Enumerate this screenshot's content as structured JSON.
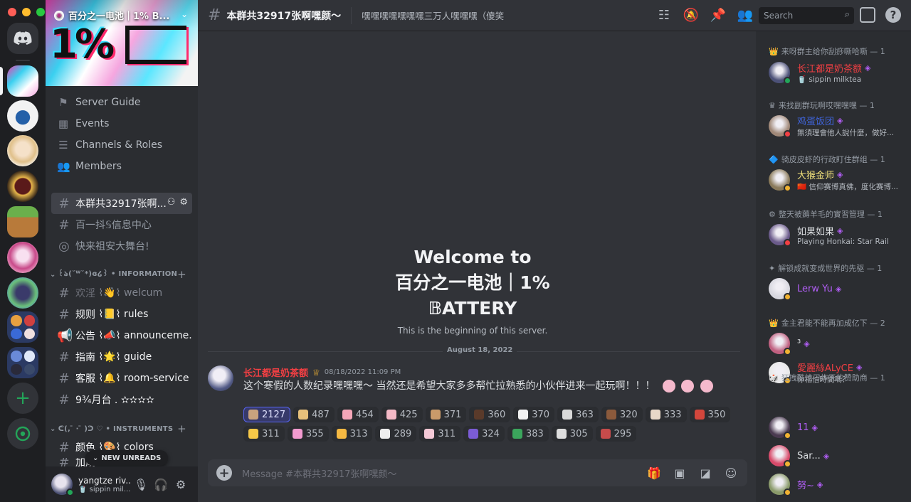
{
  "window": {
    "dots": [
      "#ff5f57",
      "#febc2e",
      "#28c840"
    ]
  },
  "server": {
    "name": "百分之一电池｜1% B...",
    "banner_text": "1%",
    "nav": [
      {
        "label": "Server Guide",
        "icon": "signpost-icon"
      },
      {
        "label": "Events",
        "icon": "calendar-icon"
      },
      {
        "label": "Channels & Roles",
        "icon": "channels-icon"
      },
      {
        "label": "Members",
        "icon": "members-icon"
      }
    ],
    "channels_top": [
      {
        "name": "本群共32917张啊...",
        "active": true
      },
      {
        "name": "百一抖𝕊信息中心"
      },
      {
        "name": "快来祖安大舞台!"
      }
    ],
    "categories": [
      "꒰ঌ(˘ᵂ˘*)ɞ໒꒱ • INFORMATION",
      "ᕦ(,  ̄ · ̄ )ᕤ ♡ • INSTRUMENTS"
    ],
    "info_channels": [
      {
        "name": "欢淫",
        "emoji": "👋",
        "sub": "welcum"
      },
      {
        "name": "规则",
        "emoji": "📒",
        "sub": "rules"
      },
      {
        "name": "公告",
        "emoji": "📣",
        "sub": "announceme..."
      },
      {
        "name": "指南",
        "emoji": "🌟",
        "sub": "guide"
      },
      {
        "name": "客服",
        "emoji": "🔔",
        "sub": "room-service"
      },
      {
        "name": "9¾月台 . ✫✫✫✫",
        "emoji": "",
        "sub": ""
      }
    ],
    "instr_channels": [
      {
        "name": "颜色",
        "emoji": "🎨",
        "sub": "colors"
      },
      {
        "name": "加成",
        "emoji": "",
        "sub": "boost"
      }
    ],
    "new_unreads": "NEW UNREADS"
  },
  "user": {
    "name": "yangtze riv...",
    "status": "🥤 sippin mil..."
  },
  "topbar": {
    "title": "本群共32917张啊嘿颜～",
    "topic": "嘿嘿嘿嘿嘿嘿嘿三万人嘿嘿嘿（傻笑",
    "search_placeholder": "Search"
  },
  "welcome": {
    "line1": "Welcome to",
    "line2": "百分之一电池｜1%",
    "line3": "𝔹ATTERY",
    "subtitle": "This is the beginning of this server.",
    "date": "August 18, 2022"
  },
  "message": {
    "author": "长江都是奶茶额",
    "timestamp": "08/18/2022 11:09 PM",
    "text": "这个寒假的人数纪录嘿嘿嘿～ 当然还是希望大家多多帮忙拉熟悉的小伙伴进来一起玩啊！！！",
    "reactions_row1": [
      {
        "count": "2127",
        "color": "#c9a37e",
        "me": true
      },
      {
        "count": "487",
        "color": "#e6c07b"
      },
      {
        "count": "454",
        "color": "#f4a6b8"
      },
      {
        "count": "425",
        "color": "#f4b9c6"
      },
      {
        "count": "371",
        "color": "#c99a6a"
      },
      {
        "count": "360",
        "color": "#5a3a2a"
      },
      {
        "count": "370",
        "color": "#f1f1f1"
      },
      {
        "count": "363",
        "color": "#d9d9d9"
      },
      {
        "count": "320",
        "color": "#8b5a3c"
      },
      {
        "count": "333",
        "color": "#e8d8c8"
      },
      {
        "count": "350",
        "color": "#d2463c"
      }
    ],
    "reactions_row2": [
      {
        "count": "311",
        "color": "#f7c948"
      },
      {
        "count": "355",
        "color": "#f39bd0"
      },
      {
        "count": "313",
        "color": "#f5b942"
      },
      {
        "count": "289",
        "color": "#eeeeee"
      },
      {
        "count": "311",
        "color": "#f4c9d6"
      },
      {
        "count": "324",
        "color": "#7b5cd6"
      },
      {
        "count": "383",
        "color": "#3ba55c"
      },
      {
        "count": "305",
        "color": "#dedede"
      },
      {
        "count": "295",
        "color": "#c54b4b"
      }
    ]
  },
  "composer": {
    "placeholder": "Message #本群共32917张啊嘿颜～"
  },
  "members": {
    "groups": [
      {
        "role": "来呀群主给你刮痧嘶哈嘶 — 1",
        "icon": "👑",
        "m": {
          "name": "长江都是奶茶额",
          "status": "🥤 sippin milktea",
          "color": "#f23f43",
          "av": "#4c5178",
          "st": "#23a559"
        }
      },
      {
        "role": "来找副群玩啊哎嘿嘿嘿 — 1",
        "icon": "♛",
        "m": {
          "name": "鸡蛋饭团",
          "status": "無須理會他人說什麼，做好...",
          "color": "#3f63d8",
          "av": "#a08878",
          "st": "#f23f43"
        }
      },
      {
        "role": "骑皮皮虾的行政盯住群组 — 1",
        "icon": "🔷",
        "m": {
          "name": "大猴金师",
          "status": "🇨🇳 信仰赛博真佛，度化赛博...",
          "color": "#f0e07a",
          "av": "#8a7a5a",
          "st": "#f0b232"
        }
      },
      {
        "role": "整天被薅羊毛的實習管理 — 1",
        "icon": "⚙",
        "m": {
          "name": "如果如果",
          "status": "Playing Honkai: Star Rail",
          "color": "#dbdee1",
          "av": "#6a5a8a",
          "st": "#f23f43"
        }
      },
      {
        "role": "解锁成就变成世界的先驱 — 1",
        "icon": "✦",
        "m": {
          "name": "Lerw Yu",
          "status": "",
          "color": "#b15ef5",
          "av": "#d8d8e0",
          "st": "#f0b232"
        }
      },
      {
        "role": "金主君能不能再加成亿下 — 2",
        "icon": "👑",
        "m": {
          "name": "³",
          "status": "",
          "color": "#dbdee1",
          "av": "#c06080",
          "st": "#f0b232"
        },
        "m2": {
          "name": "愛麗絲ALyCE",
          "status": "你相信時間嗎？",
          "color": "#f23f43",
          "av": "#e8e8e8",
          "st": "#f0b232"
        }
      },
      {
        "role": "狂拽酷炫刁炸天的赞助商 — 1",
        "icon": "🎲",
        "m": {
          "name": "11",
          "status": "",
          "color": "#b15ef5",
          "av": "#4a3a50",
          "st": "#f0b232"
        },
        "m2": {
          "name": "Sar...",
          "status": "",
          "color": "#dbdee1",
          "av": "#d84a6a",
          "st": "#f0b232"
        },
        "m3": {
          "name": "努~",
          "status": "",
          "color": "#b15ef5",
          "av": "#8a9a6a",
          "st": "#f0b232"
        }
      }
    ]
  }
}
